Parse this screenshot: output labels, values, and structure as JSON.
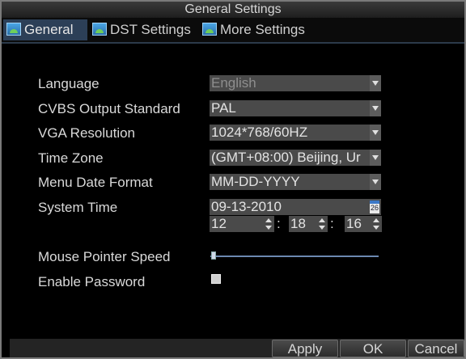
{
  "window": {
    "title": "General Settings"
  },
  "tabs": [
    {
      "label": "General",
      "icon": "landscape-icon"
    },
    {
      "label": "DST Settings",
      "icon": "landscape-icon"
    },
    {
      "label": "More Settings",
      "icon": "landscape-icon"
    }
  ],
  "form": {
    "language": {
      "label": "Language",
      "value": "English"
    },
    "cvbs": {
      "label": "CVBS Output Standard",
      "value": "PAL"
    },
    "vga": {
      "label": "VGA Resolution",
      "value": "1024*768/60HZ"
    },
    "timezone": {
      "label": "Time Zone",
      "value": "(GMT+08:00) Beijing, Ur"
    },
    "date_format": {
      "label": "Menu Date Format",
      "value": "MM-DD-YYYY"
    },
    "system_time": {
      "label": "System Time",
      "date": "09-13-2010",
      "calendar_day": "26",
      "hour": "12",
      "minute": "18",
      "second": "16",
      "separator": ":"
    },
    "mouse_speed": {
      "label": "Mouse Pointer Speed",
      "level": 0
    },
    "enable_password": {
      "label": "Enable Password",
      "checked": false
    }
  },
  "buttons": {
    "apply": "Apply",
    "ok": "OK",
    "cancel": "Cancel"
  },
  "colors": {
    "tab_active": "#2c3f57",
    "field_bg": "#4a4a4a",
    "slider": "#6c88b0"
  }
}
